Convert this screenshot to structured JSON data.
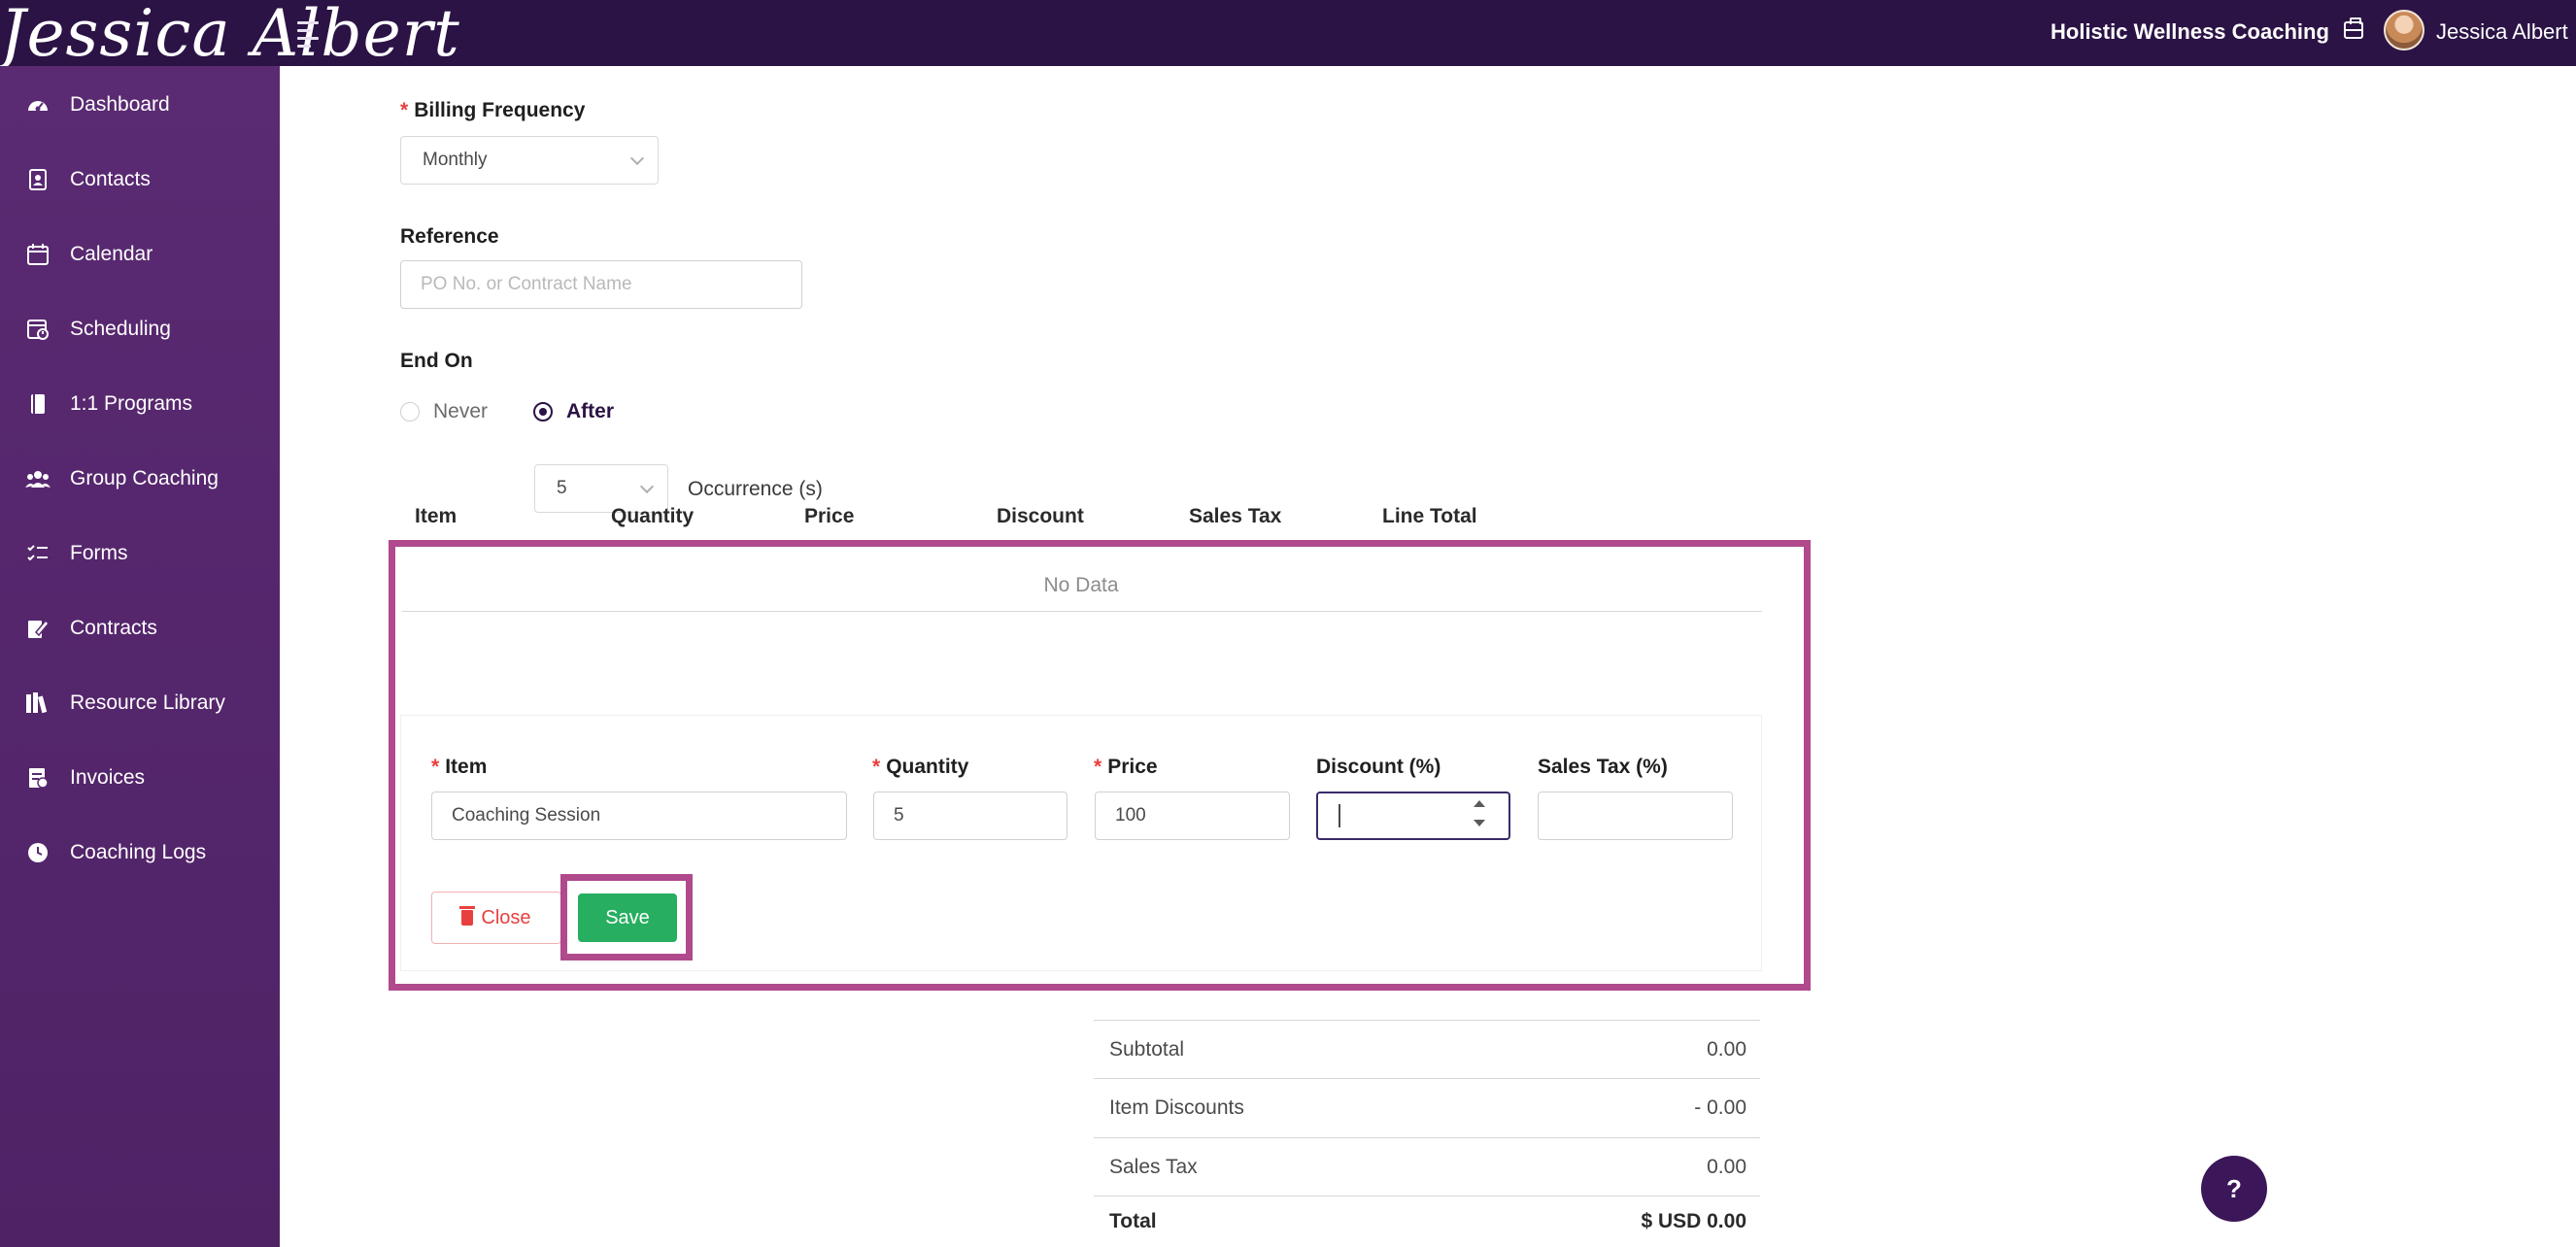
{
  "header": {
    "logo_text": "Jessica Albert",
    "business_name": "Holistic Wellness Coaching",
    "user_name": "Jessica Albert"
  },
  "sidebar": {
    "items": [
      {
        "label": "Dashboard",
        "icon": "dashboard-icon"
      },
      {
        "label": "Contacts",
        "icon": "contacts-icon"
      },
      {
        "label": "Calendar",
        "icon": "calendar-icon"
      },
      {
        "label": "Scheduling",
        "icon": "scheduling-icon"
      },
      {
        "label": "1:1 Programs",
        "icon": "book-icon"
      },
      {
        "label": "Group Coaching",
        "icon": "group-icon"
      },
      {
        "label": "Forms",
        "icon": "forms-icon"
      },
      {
        "label": "Contracts",
        "icon": "contract-icon"
      },
      {
        "label": "Resource Library",
        "icon": "library-icon"
      },
      {
        "label": "Invoices",
        "icon": "invoice-icon"
      },
      {
        "label": "Coaching Logs",
        "icon": "clock-icon"
      }
    ]
  },
  "form": {
    "billing_frequency": {
      "label": "Billing Frequency",
      "value": "Monthly"
    },
    "reference": {
      "label": "Reference",
      "placeholder": "PO No. or Contract Name",
      "value": ""
    },
    "end_on": {
      "label": "End On",
      "options": [
        "Never",
        "After"
      ],
      "selected": "After",
      "occurrences": "5",
      "occurrences_label": "Occurrence (s)"
    }
  },
  "table": {
    "columns": [
      "Item",
      "Quantity",
      "Price",
      "Discount",
      "Sales Tax",
      "Line Total"
    ],
    "empty_text": "No Data"
  },
  "line_item_form": {
    "item": {
      "label": "Item",
      "value": "Coaching Session"
    },
    "quantity": {
      "label": "Quantity",
      "value": "5"
    },
    "price": {
      "label": "Price",
      "value": "100"
    },
    "discount": {
      "label": "Discount (%)",
      "value": ""
    },
    "sales_tax": {
      "label": "Sales Tax (%)",
      "value": ""
    },
    "close_label": "Close",
    "save_label": "Save"
  },
  "summary": {
    "subtotal": {
      "label": "Subtotal",
      "value": "0.00"
    },
    "item_discounts": {
      "label": "Item Discounts",
      "value": "- 0.00"
    },
    "sales_tax": {
      "label": "Sales Tax",
      "value": "0.00"
    },
    "total": {
      "label": "Total",
      "value": "$ USD 0.00"
    }
  },
  "help_label": "?",
  "colors": {
    "topbar": "#2b1345",
    "sidebar": "#5a2a72",
    "highlight": "#b04a8c",
    "save": "#27ae60",
    "danger": "#e8403f"
  }
}
